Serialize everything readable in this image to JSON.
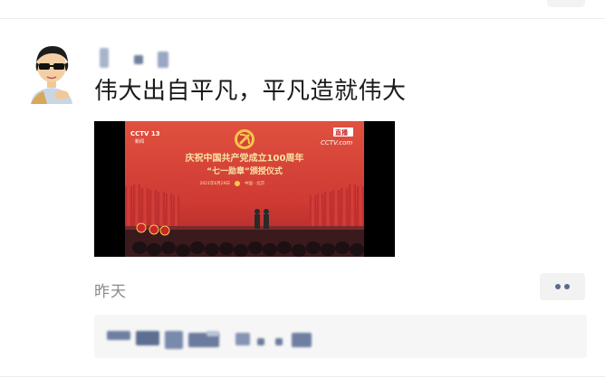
{
  "post": {
    "text": "伟大出自平凡，平凡造就伟大",
    "time": "昨天"
  },
  "video": {
    "channel_logo": "CCTV 13",
    "channel_sub": "新闻",
    "live_badge": "直播",
    "watermark": "CCTV.com",
    "title_line1": "庆祝中国共产党成立100周年",
    "title_line2": "“七一勋章”颁授仪式",
    "date_line": "2021年6月29日",
    "location": "中国 · 北京"
  },
  "icons": {
    "avatar": "cartoon-avatar-icon",
    "more": "more-dots-icon"
  },
  "colors": {
    "text": "#1a1a1a",
    "time": "#8a8a8a",
    "dots": "#5a6b8c",
    "stage_red": "#d8413a"
  }
}
